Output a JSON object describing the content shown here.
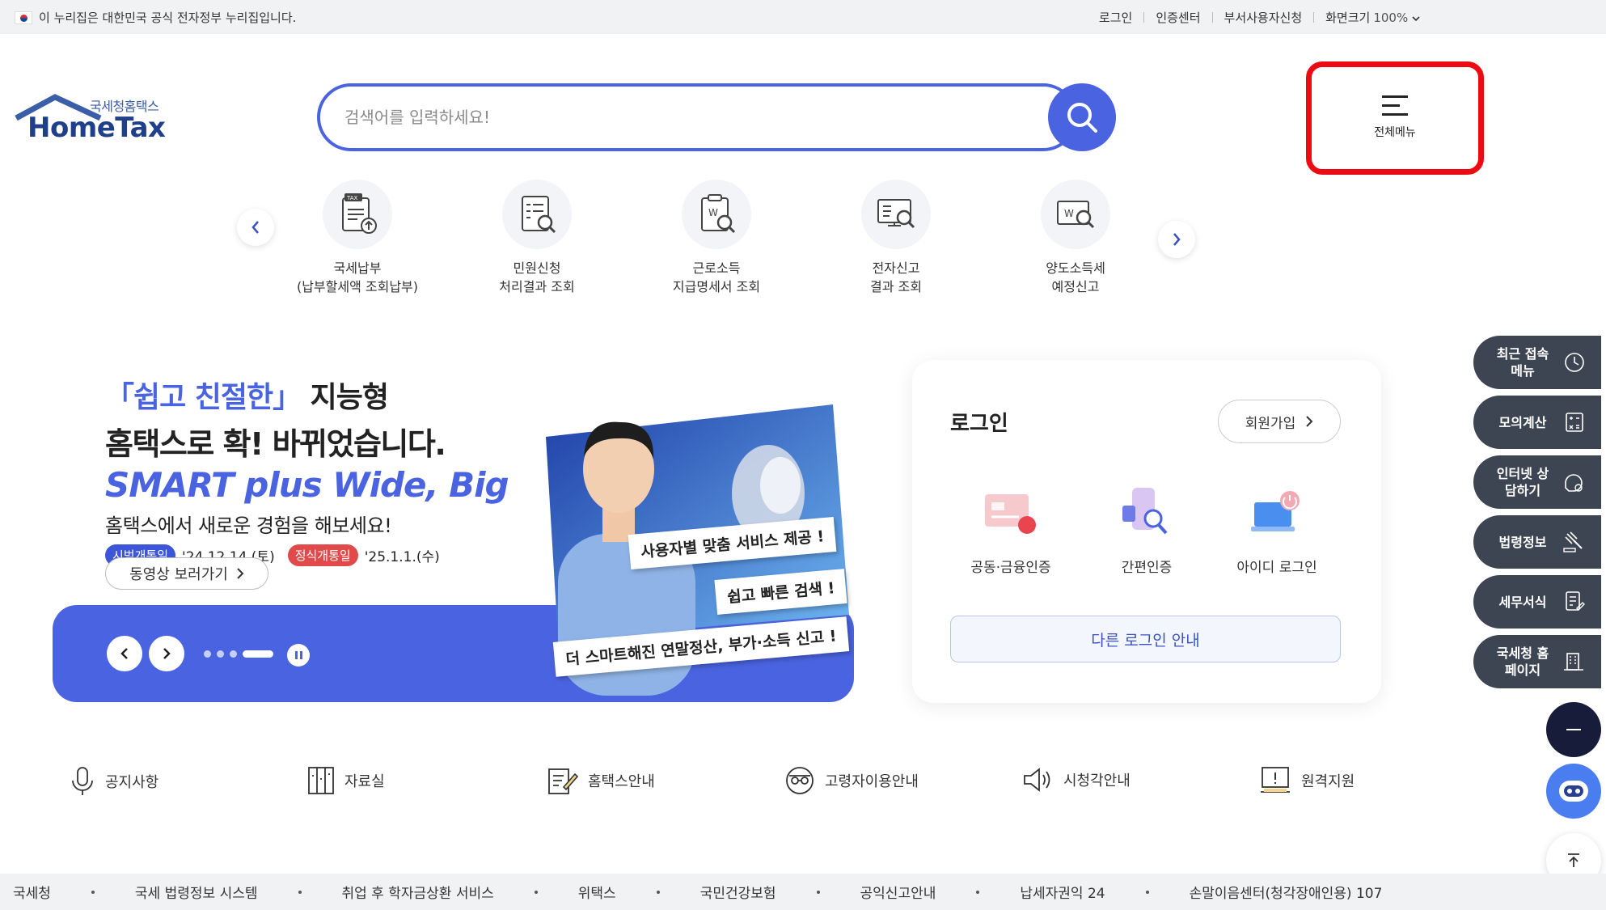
{
  "gov_banner": {
    "text": "이 누리집은 대한민국 공식 전자정부 누리집입니다.",
    "links": [
      "로그인",
      "인증센터",
      "부서사용자신청"
    ],
    "zoom_label": "화면크기",
    "zoom_value": "100%"
  },
  "logo": {
    "sub": "국세청홈택스",
    "main": "HomeTax"
  },
  "search": {
    "placeholder": "검색어를 입력하세요!"
  },
  "menu": {
    "label": "전체메뉴"
  },
  "quick_menu": [
    {
      "line1": "국세납부",
      "line2": "(납부할세액 조회납부)",
      "icon": "tax-payment-icon"
    },
    {
      "line1": "민원신청",
      "line2": "처리결과 조회",
      "icon": "civil-request-icon"
    },
    {
      "line1": "근로소득",
      "line2": "지급명세서 조회",
      "icon": "income-statement-icon"
    },
    {
      "line1": "전자신고",
      "line2": "결과 조회",
      "icon": "e-filing-icon"
    },
    {
      "line1": "양도소득세",
      "line2": "예정신고",
      "icon": "transfer-tax-icon"
    }
  ],
  "banner": {
    "hl": "「쉽고 친절한」",
    "line1_rest": " 지능형",
    "line2": "홈택스로 확! 바뀌었습니다.",
    "line3": "SMART plus Wide, Big",
    "line4": "홈택스에서 새로운 경험을 해보세요!",
    "pill1": "시범개통일",
    "date1": "'24.12.14.(토)",
    "pill2": "정식개통일",
    "date2": "'25.1.1.(수)",
    "video_btn": "동영상 보러가기",
    "speech1": "사용자별 맞춤 서비스 제공 !",
    "speech2": "쉽고 빠른 검색 !",
    "speech3": "더 스마트해진 연말정산, 부가·소득 신고 !"
  },
  "login": {
    "title": "로그인",
    "join": "회원가입",
    "options": [
      "공동·금융인증",
      "간편인증",
      "아이디 로그인"
    ],
    "other": "다른 로그인 안내"
  },
  "side_menu": [
    {
      "label": "최근 접속메뉴",
      "icon": "clock-icon"
    },
    {
      "label": "모의계산",
      "icon": "calculator-icon"
    },
    {
      "label": "인터넷 상담하기",
      "icon": "chat-icon"
    },
    {
      "label": "법령정보",
      "icon": "law-icon"
    },
    {
      "label": "세무서식",
      "icon": "form-icon"
    },
    {
      "label": "국세청 홈페이지",
      "icon": "building-icon"
    }
  ],
  "bottom_links": [
    "공지사항",
    "자료실",
    "홈택스안내",
    "고령자이용안내",
    "시청각안내",
    "원격지원"
  ],
  "footer": [
    "국세청",
    "국세 법령정보 시스템",
    "취업 후 학자금상환 서비스",
    "위택스",
    "국민건강보험",
    "공익신고안내",
    "납세자권익 24",
    "손말이음센터(청각장애인용) 107"
  ],
  "colors": {
    "primary": "#4a63e0",
    "dark_side": "#3d4553",
    "highlight_red": "#ec0b12"
  }
}
